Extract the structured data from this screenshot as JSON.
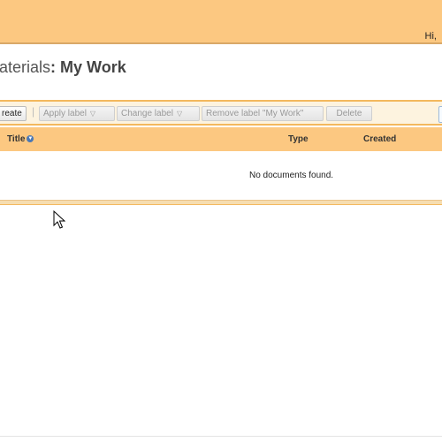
{
  "header": {
    "greeting": "Hi,"
  },
  "page": {
    "title_prefix": "aterials",
    "title_colon": ":",
    "title_main": "My Work"
  },
  "toolbar": {
    "create_label": "reate",
    "separator": "|",
    "apply_label": "Apply label",
    "change_label": "Change label",
    "remove_label": "Remove label \"My Work\"",
    "delete_label": "Delete"
  },
  "table": {
    "columns": {
      "title": "Title",
      "type": "Type",
      "created": "Created"
    },
    "empty_message": "No documents found."
  },
  "colors": {
    "header_bg": "#fcc881",
    "toolbar_border": "#f3b85e",
    "toolbar_bg": "#fdf3df"
  },
  "icons": {
    "sort": "sort-down-icon",
    "dropdown": "chevron-down-icon",
    "cursor": "mouse-pointer-icon"
  }
}
